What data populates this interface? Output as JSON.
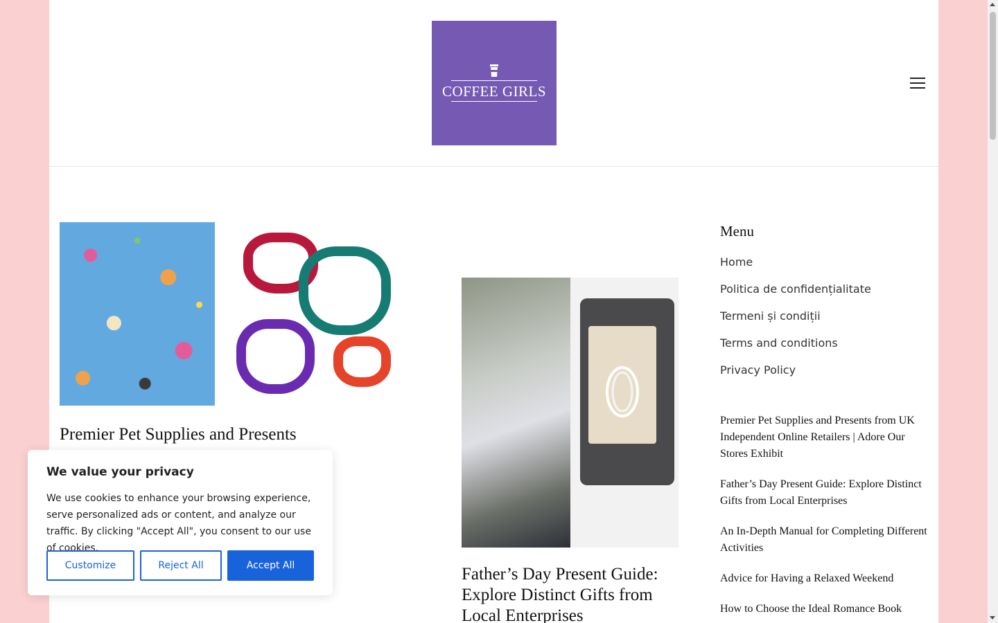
{
  "brand": {
    "logo_text": "COFFEE GIRLS",
    "logo_color": "#7559b3",
    "page_background": "#fbd0d0"
  },
  "header": {
    "menu_icon": "hamburger-icon"
  },
  "posts": [
    {
      "title": "Premier Pet Supplies and Presents",
      "image_description_icon": "pet-giftwrap-harness-image"
    },
    {
      "title": "Father’s Day Present Guide: Explore Distinct Gifts from Local Enterprises",
      "image_description_icon": "phone-pouch-image"
    }
  ],
  "sidebar": {
    "heading": "Menu",
    "menu_items": [
      "Home",
      "Politica de confidențialitate",
      "Termeni și condiții",
      "Terms and conditions",
      "Privacy Policy"
    ],
    "recent_posts": [
      "Premier Pet Supplies and Presents from UK Independent Online Retailers | Adore Our Stores Exhibit",
      "Father’s Day Present Guide: Explore Distinct Gifts from Local Enterprises",
      "An In-Depth Manual for Completing Different Activities",
      "Advice for Having a Relaxed Weekend",
      "How to Choose the Ideal Romance Book"
    ]
  },
  "cookie_banner": {
    "title": "We value your privacy",
    "text": "We use cookies to enhance your browsing experience, serve personalized ads or content, and analyze our traffic. By clicking \"Accept All\", you consent to our use of cookies.",
    "customize_label": "Customize",
    "reject_label": "Reject All",
    "accept_label": "Accept All",
    "accent_color": "#1863dc"
  }
}
